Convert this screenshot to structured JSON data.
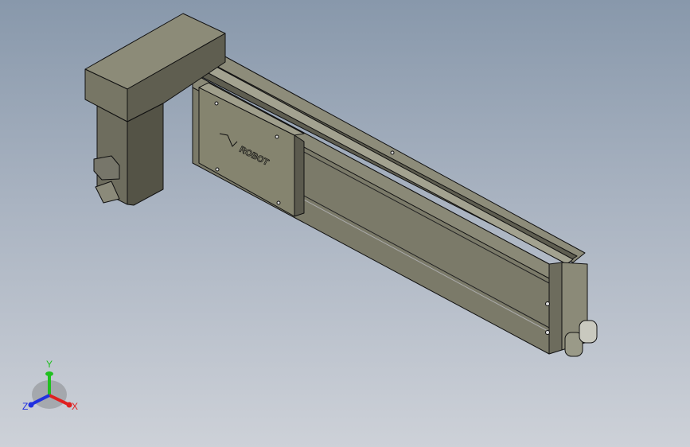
{
  "model": {
    "logo_text": "ROBOT",
    "body_color": "#7b7a69",
    "edge_color": "#111111"
  },
  "triad": {
    "x_label": "X",
    "y_label": "Y",
    "z_label": "Z",
    "x_color": "#e02020",
    "y_color": "#20c020",
    "z_color": "#2030e0"
  }
}
